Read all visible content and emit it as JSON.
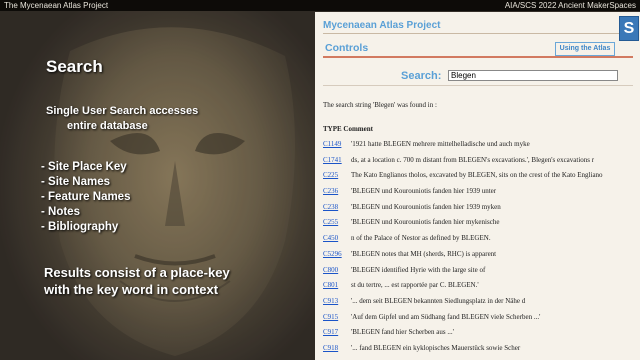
{
  "topbar": {
    "left": "The Mycenaean Atlas  Project",
    "right": "AIA/SCS 2022 Ancient MakerSpaces"
  },
  "slide": {
    "title": "Search",
    "line1": "Single User Search accesses",
    "line2": "entire database",
    "bullets": [
      "- Site Place Key",
      "- Site Names",
      "- Feature Names",
      "- Notes",
      "- Bibliography"
    ],
    "result1": "Results consist of a place-key",
    "result2": "with the key word in context"
  },
  "panel": {
    "site_title": "Mycenaean Atlas Project",
    "seal": "S",
    "controls_label": "Controls",
    "using_button": "Using the Atlas",
    "search_label": "Search:",
    "search_value": "Blegen",
    "found_text": "The search string 'Blegen' was found in :",
    "type_head": "TYPE Comment",
    "results": [
      {
        "code": "C1149",
        "ctx": "'1921 hatte BLEGEN mehrere mittelhelladische und auch myke"
      },
      {
        "code": "C1741",
        "ctx": "ds, at a location c. 700 m distant from BLEGEN's excavations.', Blegen's excavations r"
      },
      {
        "code": "C225",
        "ctx": "The Kato Englianos tholos, excavated by BLEGEN, sits on the crest of the Kato Engliano"
      },
      {
        "code": "C236",
        "ctx": "'BLEGEN und Kourouniotis fanden hier 1939 unter"
      },
      {
        "code": "C238",
        "ctx": "'BLEGEN und Kourouniotis fanden hier 1939 myken"
      },
      {
        "code": "C255",
        "ctx": "'BLEGEN und Kourouniotis fanden hier mykenische"
      },
      {
        "code": "C450",
        "ctx": "n of the Palace of Nestor as defined by BLEGEN."
      },
      {
        "code": "C5296",
        "ctx": "'BLEGEN notes that MH (sherds, RHC) is apparent"
      },
      {
        "code": "C800",
        "ctx": "'BLEGEN identified Hyrie with the large site of"
      },
      {
        "code": "C801",
        "ctx": "st du tertre, ... est rapportée par C. BLEGEN.'"
      },
      {
        "code": "C913",
        "ctx": "'... dem seit BLEGEN bekannten Siedlungsplatz in der Nähe d"
      },
      {
        "code": "C915",
        "ctx": "'Auf dem Gipfel und am Südhang fand BLEGEN viele Scherben ...'"
      },
      {
        "code": "C917",
        "ctx": "'BLEGEN fand hier Scherben aus ...'"
      },
      {
        "code": "C918",
        "ctx": "'... fand BLEGEN ein kyklopisches Mauerstück sowie Scher"
      }
    ]
  },
  "colors": {
    "accent_blue": "#5aa0d6",
    "link_blue": "#1a54c8",
    "rule_red": "#d27a60",
    "panel_bg": "#f6f2ea"
  }
}
